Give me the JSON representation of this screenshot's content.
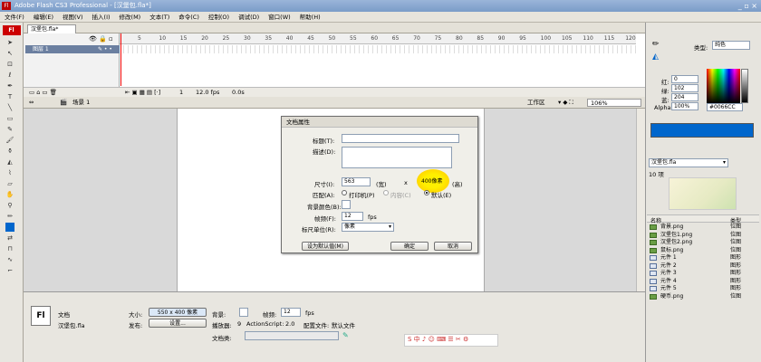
{
  "window": {
    "title": "Adobe Flash CS3 Professional - [汉堡包.fla*]",
    "logo": "Fl"
  },
  "menu": [
    "文件(F)",
    "编辑(E)",
    "视图(V)",
    "插入(I)",
    "修改(M)",
    "文本(T)",
    "命令(C)",
    "控制(O)",
    "调试(D)",
    "窗口(W)",
    "帮助(H)"
  ],
  "doc_tab": "汉堡包.fla*",
  "timeline": {
    "layer_name": "图层 1",
    "frame_numbers": [
      "5",
      "10",
      "15",
      "20",
      "25",
      "30",
      "35",
      "40",
      "45",
      "50",
      "55",
      "60",
      "65",
      "70",
      "75",
      "80",
      "85",
      "90",
      "95",
      "100",
      "105",
      "110",
      "115",
      "120"
    ],
    "status_frame": "1",
    "fps": "12.0 fps",
    "time": "0.0s"
  },
  "scene": {
    "name": "场景 1",
    "workspace": "工作区",
    "zoom": "106%"
  },
  "dialog": {
    "title": "文档属性",
    "title_label": "标题(T):",
    "desc_label": "描述(D):",
    "size_label": "尺寸(I):",
    "width": "563",
    "width_unit": "(宽)",
    "times": "x",
    "height": "400像素",
    "height_unit": "(高)",
    "match_label": "匹配(A):",
    "match_printer": "打印机(P)",
    "match_content": "内容(C)",
    "match_default": "默认(E)",
    "bg_label": "背景颜色(B):",
    "fps_label": "帧频(F):",
    "fps_value": "12",
    "fps_unit": "fps",
    "ruler_label": "标尺单位(R):",
    "ruler_value": "像素",
    "set_default": "设为默认值(M)",
    "ok": "确定",
    "cancel": "取消"
  },
  "properties": {
    "doc_label": "文档",
    "doc_file": "汉堡包.fla",
    "size_label": "大小:",
    "size_value": "550 x 400 像素",
    "bg_label": "背景:",
    "fps_label": "帧频:",
    "fps_value": "12",
    "fps_unit": "fps",
    "publish_label": "发布:",
    "settings_btn": "设置...",
    "player_label": "播放器:",
    "player_value": "9",
    "as_label": "ActionScript:",
    "as_value": "2.0",
    "profile_label": "配置文件:",
    "profile_value": "默认文件",
    "docclass_label": "文档类:"
  },
  "color": {
    "type_label": "类型:",
    "type_value": "纯色",
    "r_label": "红:",
    "r_value": "0",
    "g_label": "绿:",
    "g_value": "102",
    "b_label": "蓝:",
    "b_value": "204",
    "alpha_label": "Alpha:",
    "alpha_value": "100%",
    "hex": "#0066CC",
    "swatch_color": "#0066cc"
  },
  "library": {
    "file": "汉堡包.fla",
    "count": "10 项",
    "col_name": "名称",
    "col_type": "类型",
    "items": [
      {
        "name": "背景.png",
        "type": "位图"
      },
      {
        "name": "汉堡包1.png",
        "type": "位图"
      },
      {
        "name": "汉堡包2.png",
        "type": "位图"
      },
      {
        "name": "鼠标.png",
        "type": "位图"
      },
      {
        "name": "元件 1",
        "type": "图形"
      },
      {
        "name": "元件 2",
        "type": "图形"
      },
      {
        "name": "元件 3",
        "type": "图形"
      },
      {
        "name": "元件 4",
        "type": "图形"
      },
      {
        "name": "元件 5",
        "type": "图形"
      },
      {
        "name": "硬币.png",
        "type": "位图"
      }
    ]
  }
}
